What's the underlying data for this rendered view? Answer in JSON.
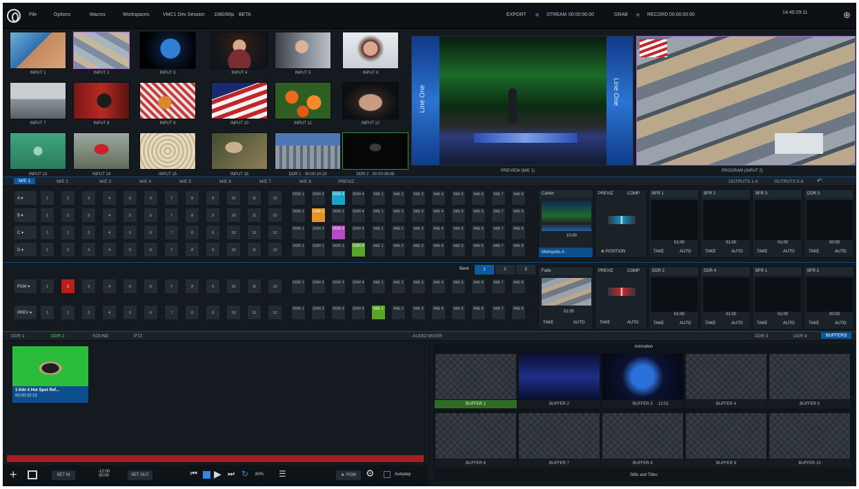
{
  "menu": {
    "items": [
      "File",
      "Options",
      "Macros",
      "Workspaces",
      "VMC1 Dev Session",
      "1080/60p",
      "BETA"
    ],
    "export": "EXPORT",
    "stream": "STREAM",
    "stream_time": "00:00:00:00",
    "grab": "GRAB",
    "record": "RECORD",
    "record_time": "00:00:00:00",
    "time": "14:40:29:11"
  },
  "inputs": [
    "INPUT 1",
    "INPUT 2",
    "INPUT 3",
    "INPUT 4",
    "INPUT 5",
    "INPUT 6",
    "INPUT 7",
    "INPUT 8",
    "INPUT 9",
    "INPUT 10",
    "INPUT 11",
    "INPUT 12",
    "INPUT 13",
    "INPUT 14",
    "INPUT 15",
    "INPUT 16",
    "DDR 1 · 00:00:10:23",
    "DDR 2 · 00:00:06:06"
  ],
  "monitors": {
    "preview": "PREVIEW (M/E 1)",
    "program": "PROGRAM (INPUT 2)",
    "set_text": "Line One"
  },
  "me_tabs": [
    "M/E 1",
    "M/E 2",
    "M/E 3",
    "M/E 4",
    "M/E 5",
    "M/E 6",
    "M/E 7",
    "M/E 8",
    "PREVIZ"
  ],
  "outputs": [
    "OUTPUTS 1-4",
    "OUTPUTS 5-8"
  ],
  "me_rows": [
    {
      "label": "A ▾",
      "extras": [
        "DDR 1",
        "DDR 2",
        "DDR 3",
        "DDR 4",
        "M/E 1",
        "M/E 2",
        "M/E 3",
        "M/E 4",
        "M/E 5",
        "M/E 6",
        "M/E 7",
        "M/E 8"
      ]
    },
    {
      "label": "B ▾",
      "extras": [
        "DDR 1",
        "DDR 2",
        "DDR 3",
        "DDR 4",
        "M/E 1",
        "M/E 2",
        "M/E 3",
        "M/E 4",
        "M/E 5",
        "M/E 6",
        "M/E 7",
        "M/E 8"
      ]
    },
    {
      "label": "C ▾",
      "extras": [
        "DDR 1",
        "DDR 2",
        "DDR 3",
        "DDR 4",
        "M/E 1",
        "M/E 2",
        "M/E 3",
        "M/E 4",
        "M/E 5",
        "M/E 6",
        "M/E 7",
        "M/E 8"
      ]
    },
    {
      "label": "D ▾",
      "extras": [
        "DDR 1",
        "DDR 2",
        "DDR 3",
        "DDR 4",
        "M/E 1",
        "M/E 2",
        "M/E 3",
        "M/E 4",
        "M/E 5",
        "M/E 6",
        "M/E 7",
        "M/E 8"
      ]
    }
  ],
  "main_rows": [
    {
      "label": "PGM ▾",
      "extras": [
        "DDR 1",
        "DDR 2",
        "DDR 3",
        "DDR 4",
        "M/E 1",
        "M/E 2",
        "M/E 3",
        "M/E 4",
        "M/E 5",
        "M/E 6",
        "M/E 7",
        "M/E 8"
      ]
    },
    {
      "label": "PREV ▾",
      "extras": [
        "DDR 1",
        "DDR 2",
        "DDR 3",
        "DDR 4",
        "M/E 1",
        "M/E 2",
        "M/E 3",
        "M/E 4",
        "M/E 5",
        "M/E 6",
        "M/E 7",
        "M/E 8"
      ]
    }
  ],
  "numbers": [
    "1",
    "2",
    "3",
    "4",
    "5",
    "6",
    "7",
    "8",
    "9",
    "10",
    "11",
    "12"
  ],
  "bank": {
    "label": "Bank",
    "values": [
      "1",
      "2",
      "3"
    ]
  },
  "me_panel": {
    "transition": "Cartier",
    "time": "10.00",
    "set_name": "Metropolis A",
    "previz": "PREVIZ",
    "comp": "COMP",
    "position": "POSITION",
    "take": "TAKE",
    "auto": "AUTO"
  },
  "dsk_top": [
    {
      "name": "BFR 1",
      "time": "01:00"
    },
    {
      "name": "BFR 2",
      "time": "01:00"
    },
    {
      "name": "BFR 3",
      "time": "01:00"
    },
    {
      "name": "DDR 3",
      "time": "00:00"
    }
  ],
  "main_panel": {
    "transition": "Fade",
    "time": "01:00",
    "previz": "PREVIZ",
    "comp": "COMP",
    "take": "TAKE",
    "auto": "AUTO"
  },
  "dsk_bottom": [
    {
      "name": "DDR 2",
      "time": "01:00"
    },
    {
      "name": "DDR 4",
      "time": "01:00"
    },
    {
      "name": "BFR 1",
      "time": "01:00"
    },
    {
      "name": "BFR 2",
      "time": "00:00"
    }
  ],
  "bottom_tabs": {
    "left": [
      "DDR 1",
      "DDR 2",
      "SOUND",
      "PTZ"
    ],
    "center": "AUDIO MIXER",
    "right": [
      "DDR 3",
      "DDR 4",
      "BUFFERS"
    ]
  },
  "ddr": {
    "clip_title": "1 Kiki 4 Hot Spot Ref...",
    "clip_time": "00:00:02:15",
    "set_in": "SET IN",
    "set_out": "SET OUT",
    "dur": "-12:00",
    "dur2": "00:00",
    "speed": "80%",
    "pgm": "► PGM",
    "autoplay": "Autoplay"
  },
  "buffers": {
    "header": "Animation",
    "footer": "Stills and Titles",
    "items": [
      "BUFFER 1",
      "BUFFER 2",
      "BUFFER 3",
      "BUFFER 4",
      "BUFFER 5",
      "BUFFER 6",
      "BUFFER 7",
      "BUFFER 8",
      "BUFFER 9",
      "BUFFER 10"
    ],
    "buffer3_time": "12:01"
  }
}
